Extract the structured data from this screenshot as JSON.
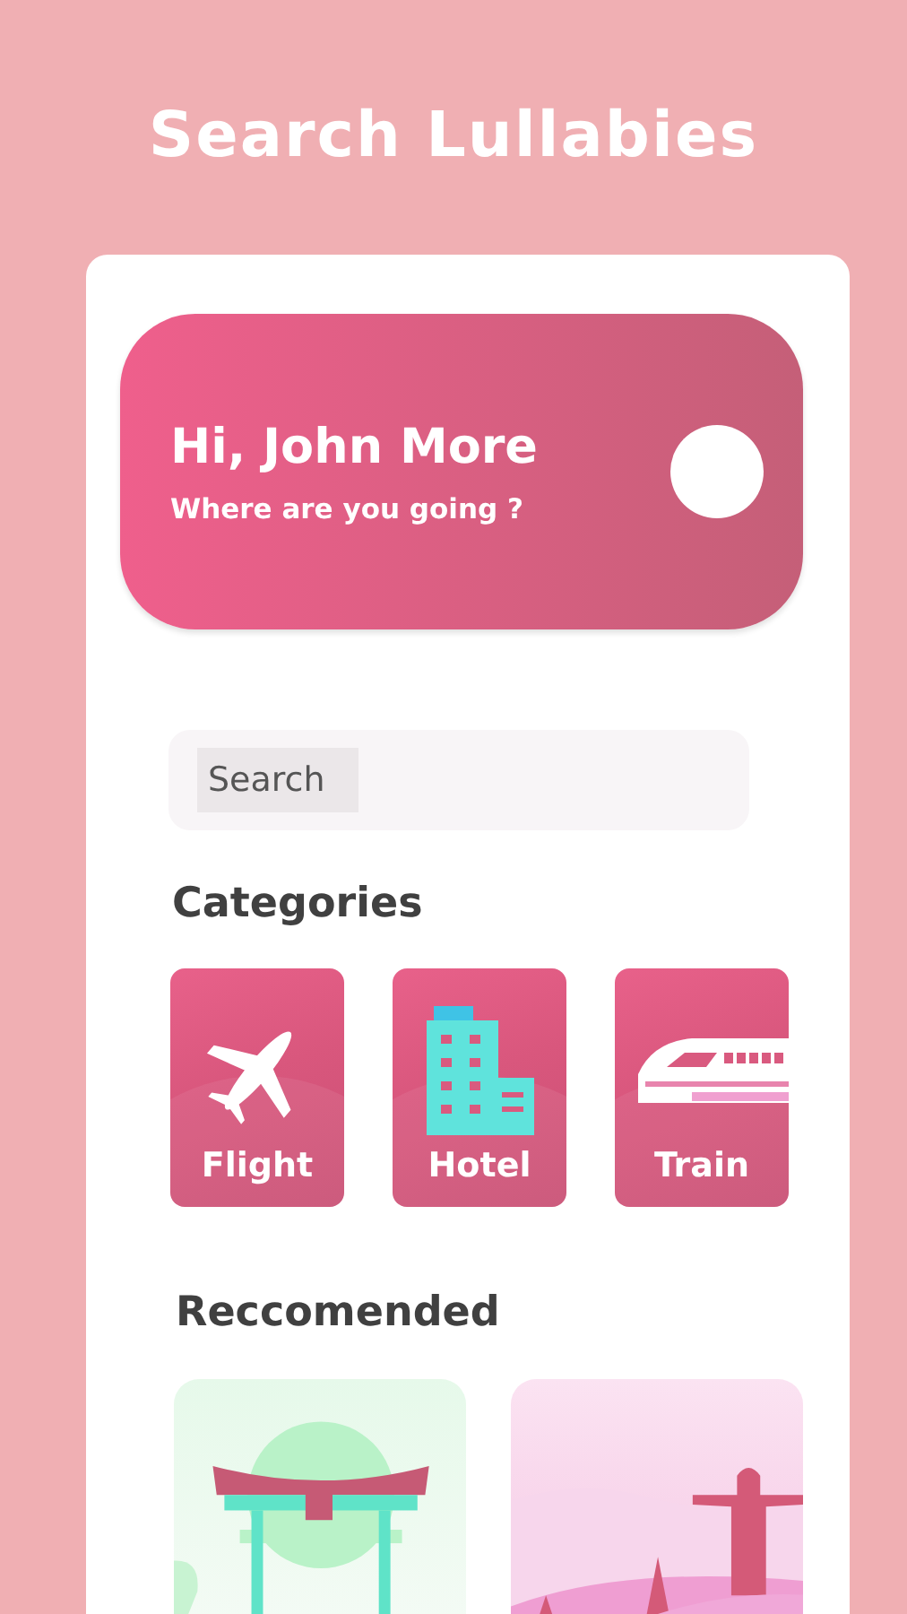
{
  "title": "Search Lullabies",
  "greeting": {
    "name": "Hi, John More",
    "subtitle": "Where are you going ?"
  },
  "search": {
    "placeholder": "Search"
  },
  "categories": {
    "heading": "Categories",
    "items": [
      {
        "label": "Flight",
        "kind": "plane"
      },
      {
        "label": "Hotel",
        "kind": "building"
      },
      {
        "label": "Train",
        "kind": "train"
      }
    ]
  },
  "recommended": {
    "heading": "Reccomended",
    "items": [
      {
        "kind": "gate"
      },
      {
        "kind": "statue"
      }
    ]
  }
}
